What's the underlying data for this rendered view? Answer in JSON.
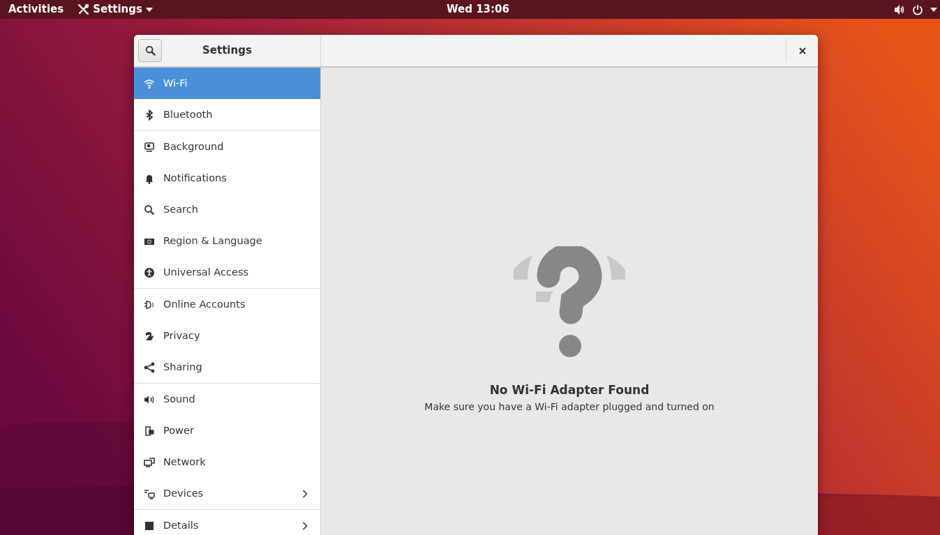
{
  "top_bar": {
    "activities": "Activities",
    "app_menu": "Settings",
    "clock": "Wed 13:06"
  },
  "window": {
    "title": "Settings"
  },
  "sidebar": {
    "groups": [
      {
        "items": [
          {
            "label": "Wi-Fi",
            "selected": true,
            "has_submenu": false
          },
          {
            "label": "Bluetooth",
            "selected": false,
            "has_submenu": false
          }
        ]
      },
      {
        "items": [
          {
            "label": "Background",
            "selected": false,
            "has_submenu": false
          },
          {
            "label": "Notifications",
            "selected": false,
            "has_submenu": false
          },
          {
            "label": "Search",
            "selected": false,
            "has_submenu": false
          },
          {
            "label": "Region & Language",
            "selected": false,
            "has_submenu": false
          },
          {
            "label": "Universal Access",
            "selected": false,
            "has_submenu": false
          }
        ]
      },
      {
        "items": [
          {
            "label": "Online Accounts",
            "selected": false,
            "has_submenu": false
          },
          {
            "label": "Privacy",
            "selected": false,
            "has_submenu": false
          },
          {
            "label": "Sharing",
            "selected": false,
            "has_submenu": false
          }
        ]
      },
      {
        "items": [
          {
            "label": "Sound",
            "selected": false,
            "has_submenu": false
          },
          {
            "label": "Power",
            "selected": false,
            "has_submenu": false
          },
          {
            "label": "Network",
            "selected": false,
            "has_submenu": false
          },
          {
            "label": "Devices",
            "selected": false,
            "has_submenu": true
          }
        ]
      },
      {
        "items": [
          {
            "label": "Details",
            "selected": false,
            "has_submenu": true
          }
        ]
      }
    ]
  },
  "content": {
    "heading": "No Wi-Fi Adapter Found",
    "message": "Make sure you have a Wi-Fi adapter plugged and turned on"
  }
}
